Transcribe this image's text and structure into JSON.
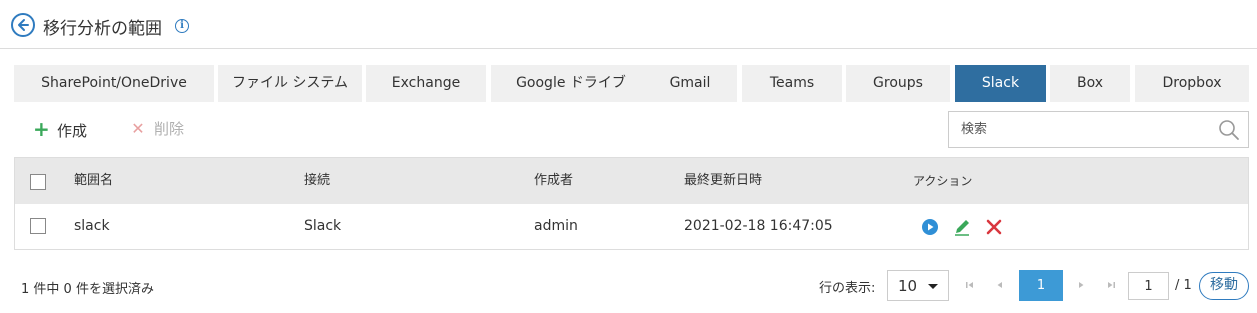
{
  "header": {
    "title": "移行分析の範囲",
    "info_icon": "info-icon",
    "back_icon": "arrow-left-circle-icon"
  },
  "tabs": [
    {
      "label": "SharePoint/OneDrive",
      "active": false
    },
    {
      "label": "ファイル システム",
      "active": false
    },
    {
      "label": "Exchange",
      "active": false
    },
    {
      "label": "Google ドライブ",
      "active": false
    },
    {
      "label": "Gmail",
      "active": false
    },
    {
      "label": "Teams",
      "active": false
    },
    {
      "label": "Groups",
      "active": false
    },
    {
      "label": "Slack",
      "active": true
    },
    {
      "label": "Box",
      "active": false
    },
    {
      "label": "Dropbox",
      "active": false
    }
  ],
  "toolbar": {
    "create_label": "作成",
    "delete_label": "削除",
    "search_placeholder": "検索"
  },
  "table": {
    "headers": [
      "範囲名",
      "接続",
      "作成者",
      "最終更新日時",
      "アクション"
    ],
    "rows": [
      {
        "name": "slack",
        "connection": "Slack",
        "creator": "admin",
        "modified": "2021-02-18 16:47:05",
        "actions": [
          "play-icon",
          "edit-pencil-icon",
          "delete-x-icon"
        ]
      }
    ]
  },
  "footer": {
    "selection_text": "1 件中 0 件を選択済み",
    "rows_label": "行の表示:",
    "rows_value": "10",
    "current_page": "1",
    "page_input": "1",
    "page_total": "/ 1",
    "go_label": "移動"
  },
  "colors": {
    "accent": "#2f6ea0",
    "pager_active": "#3d9ad6",
    "create_green": "#3aa85a",
    "delete_red": "#d9363e"
  }
}
